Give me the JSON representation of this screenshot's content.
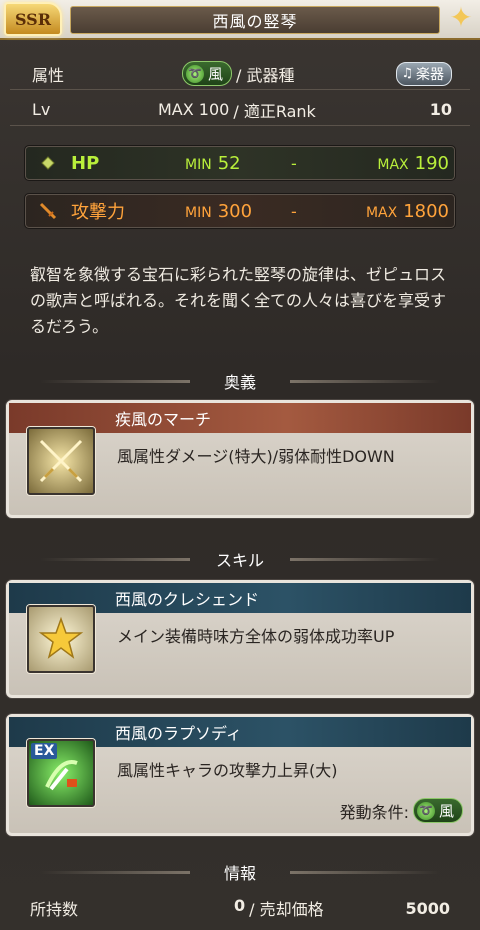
{
  "header": {
    "rarity": "SSR",
    "title": "西風の竪琴"
  },
  "attr_row": {
    "label": "属性",
    "element": "風",
    "weapon_type_label": "/ 武器種",
    "weapon_type": "楽器"
  },
  "lv_row": {
    "label": "Lv",
    "max_level": "MAX 100",
    "rank_label": "/ 適正Rank",
    "rank": "10"
  },
  "hp": {
    "label": "HP",
    "min_label": "MIN",
    "min": "52",
    "dash": "-",
    "max_label": "MAX",
    "max": "190"
  },
  "atk": {
    "label": "攻撃力",
    "min_label": "MIN",
    "min": "300",
    "dash": "-",
    "max_label": "MAX",
    "max": "1800"
  },
  "description": "叡智を象徴する宝石に彩られた竪琴の旋律は、ゼピュロスの歌声と呼ばれる。それを聞く全ての人々は喜びを享受するだろう。",
  "sections": {
    "ougi": "奥義",
    "skill": "スキル",
    "info": "情報"
  },
  "ougi": {
    "name": "疾風のマーチ",
    "effect": "風属性ダメージ(特大)/弱体耐性DOWN"
  },
  "skills": [
    {
      "name": "西風のクレシェンド",
      "effect": "メイン装備時味方全体の弱体成功率UP"
    },
    {
      "name": "西風のラプソディ",
      "effect": "風属性キャラの攻撃力上昇(大)",
      "badge": "EX",
      "condition_label": "発動条件:",
      "condition_element": "風"
    }
  ],
  "info": {
    "owned_label": "所持数",
    "owned": "0",
    "sell_label": "/ 売却価格",
    "sell": "5000"
  },
  "colors": {
    "hp": "#b9ef3b",
    "atk": "#ffa33b",
    "ougi_header": "#a45a40",
    "skill_header": "#2c5266"
  }
}
